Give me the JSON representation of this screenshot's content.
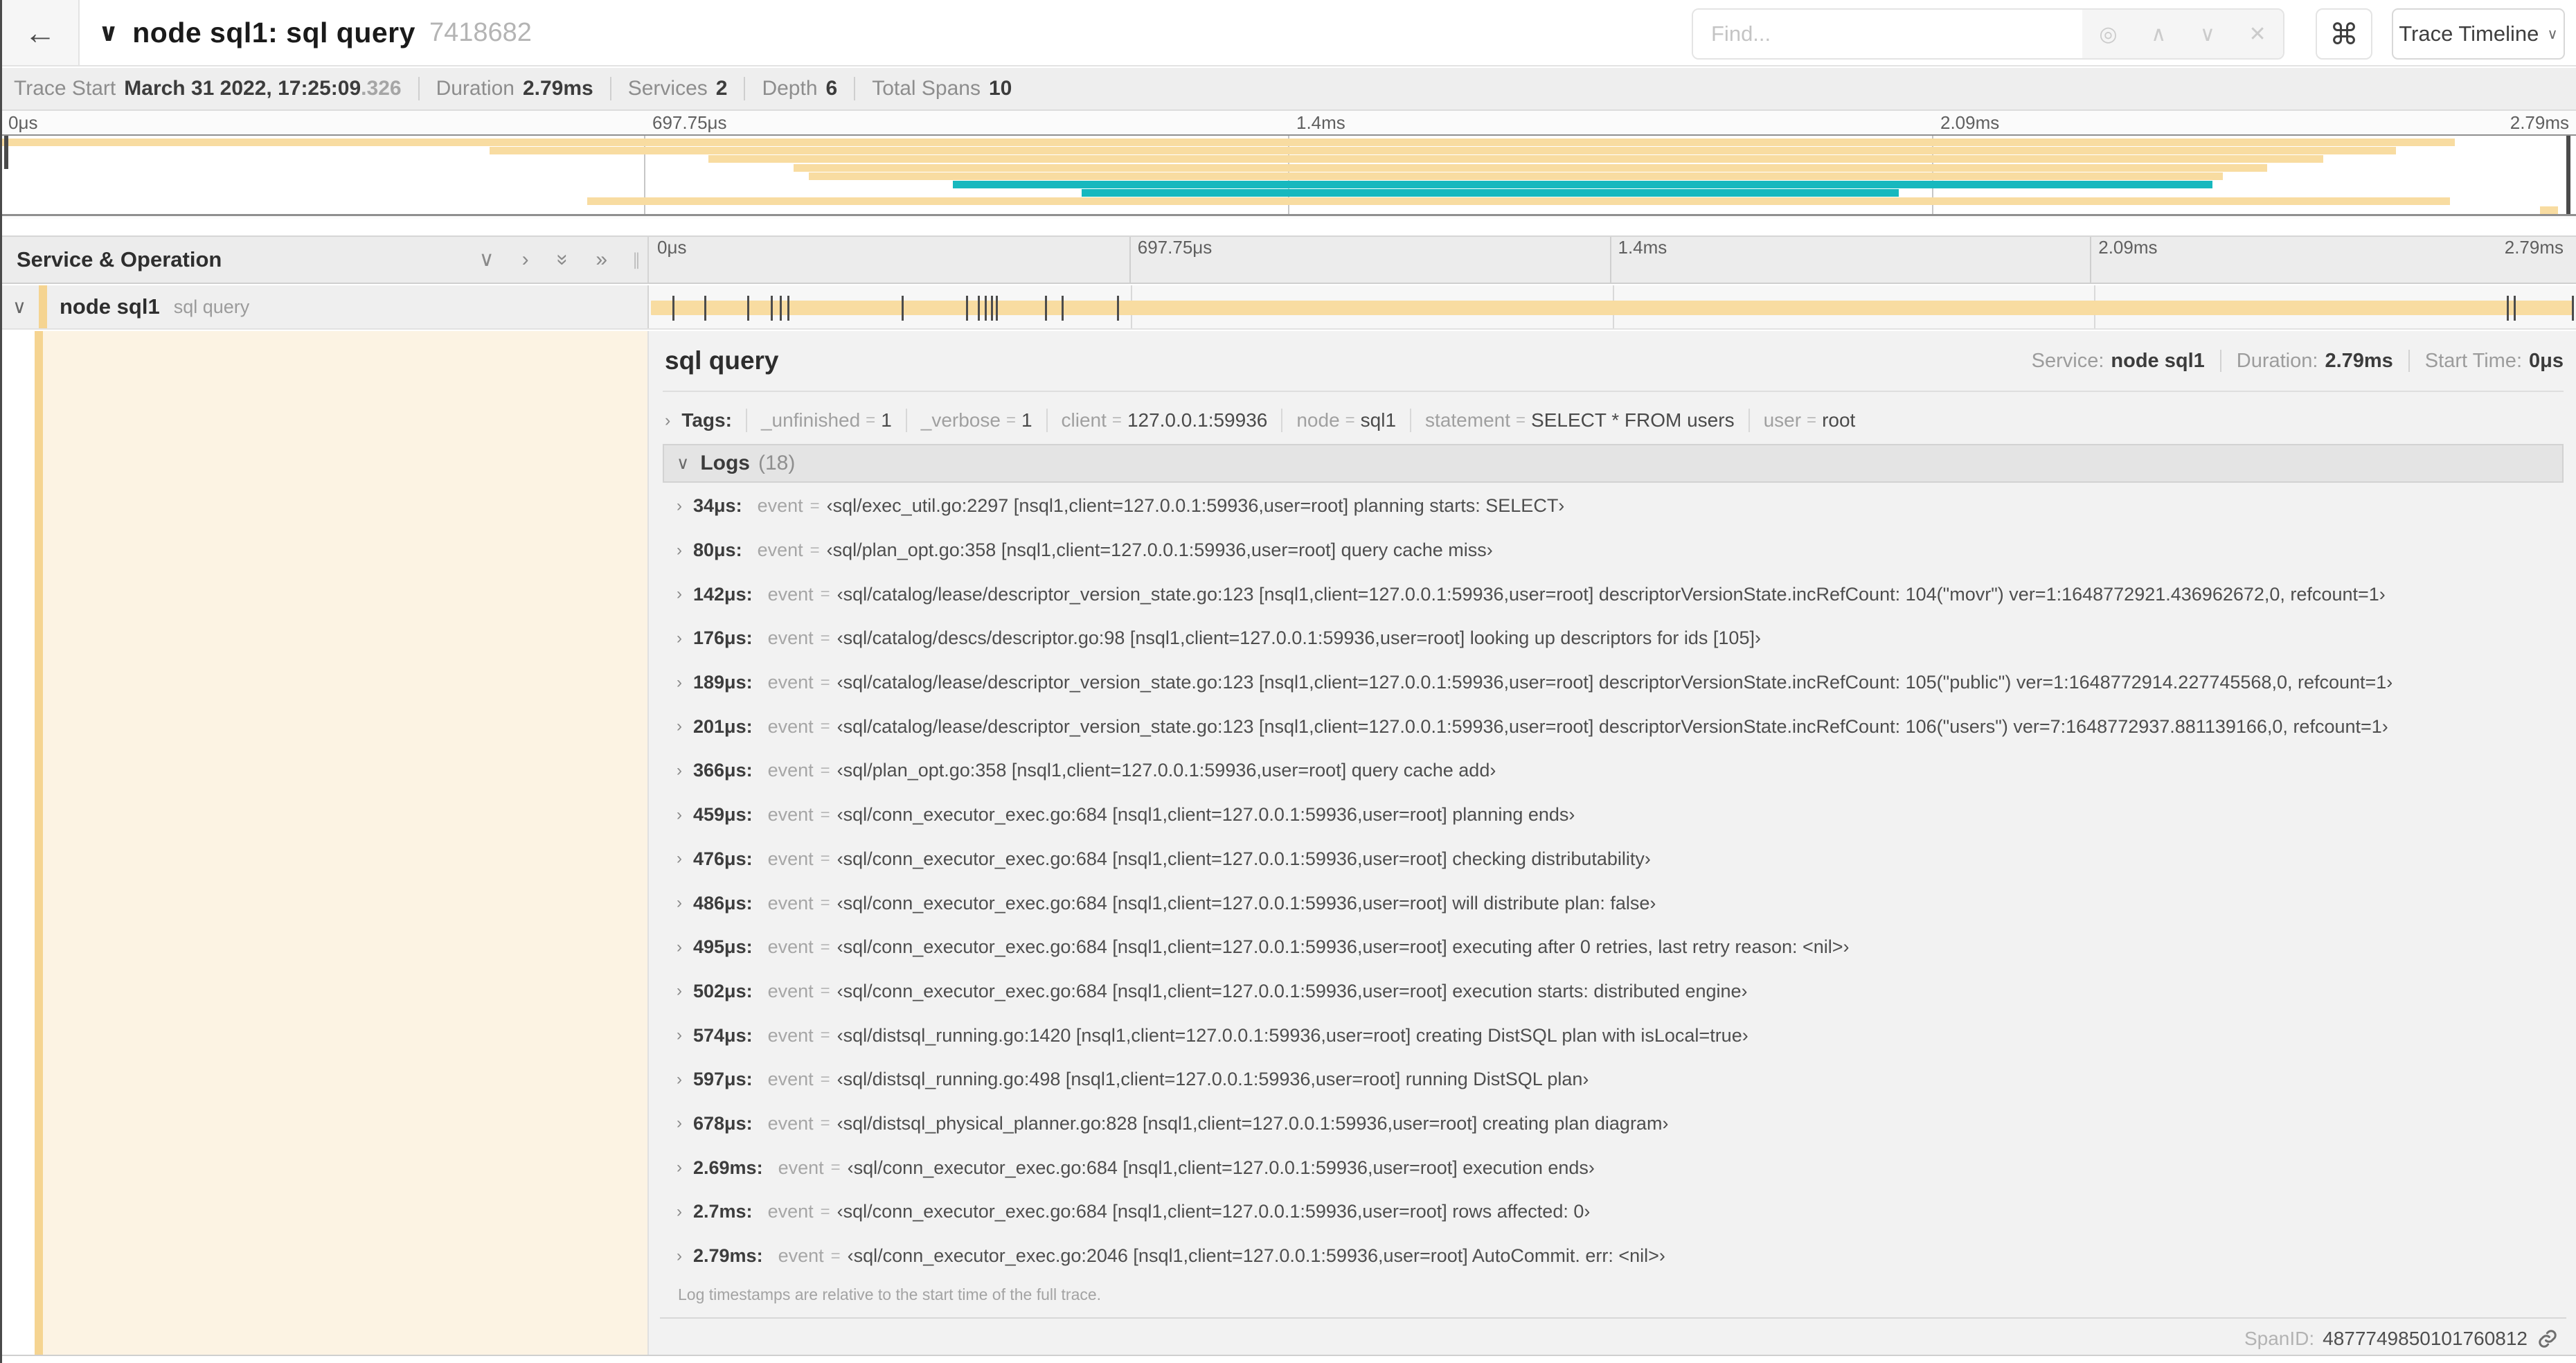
{
  "colors": {
    "tan": "#F8DCA1",
    "teal": "#17B8BE",
    "stripe": "#F5D491"
  },
  "topbar": {
    "back_icon": "←",
    "collapse_icon": "∨",
    "title": "node sql1: sql query",
    "trace_id": "7418682",
    "find_placeholder": "Find...",
    "shortcut_icon": "⌘",
    "view_selector": "Trace Timeline",
    "view_chevron": "∨"
  },
  "meta": {
    "items": [
      {
        "label": "Trace Start",
        "value": "March 31 2022, 17:25:09",
        "muted_suffix": ".326"
      },
      {
        "label": "Duration",
        "value": "2.79ms"
      },
      {
        "label": "Services",
        "value": "2"
      },
      {
        "label": "Depth",
        "value": "6"
      },
      {
        "label": "Total Spans",
        "value": "10"
      }
    ]
  },
  "ruler": {
    "labels": [
      "0μs",
      "697.75μs",
      "1.4ms",
      "2.09ms",
      "2.79ms"
    ],
    "fractions": [
      0,
      25,
      50,
      75,
      100
    ]
  },
  "minimap": {
    "rows": [
      {
        "start": 0,
        "end": 95.3,
        "color": "tan"
      },
      {
        "start": 19,
        "end": 93,
        "color": "tan"
      },
      {
        "start": 27.5,
        "end": 90.2,
        "color": "tan"
      },
      {
        "start": 30.8,
        "end": 88,
        "color": "tan"
      },
      {
        "start": 31.4,
        "end": 86.3,
        "color": "tan"
      },
      {
        "start": 37,
        "end": 85.9,
        "color": "teal"
      },
      {
        "start": 42,
        "end": 73.7,
        "color": "teal"
      },
      {
        "start": 22.8,
        "end": 95.1,
        "color": "tan"
      },
      {
        "start": 98.6,
        "end": 99.3,
        "color": "tan"
      }
    ]
  },
  "timeline": {
    "column_header": "Service & Operation",
    "expander_icons": {
      "collapse_one": "∨",
      "expand_one": "›",
      "collapse_all": "»",
      "expand_all": "»"
    },
    "row": {
      "expander": "∨",
      "service": "node sql1",
      "operation": "sql query"
    },
    "bar": {
      "start_pct": 0.1,
      "end_pct": 99.9
    },
    "tick_fractions": [
      1.22,
      2.87,
      5.09,
      6.31,
      6.78,
      7.2,
      13.12,
      16.45,
      17.06,
      17.42,
      17.74,
      18.0,
      20.57,
      21.4,
      24.3,
      96.42,
      96.77,
      99.8
    ]
  },
  "detail": {
    "title": "sql query",
    "overview": [
      {
        "label": "Service:",
        "value": "node sql1"
      },
      {
        "label": "Duration:",
        "value": "2.79ms"
      },
      {
        "label": "Start Time:",
        "value": "0μs"
      }
    ],
    "tags_chevron": "›",
    "tags_label": "Tags:",
    "tags": [
      {
        "key": "_unfinished",
        "value": "1"
      },
      {
        "key": "_verbose",
        "value": "1"
      },
      {
        "key": "client",
        "value": "127.0.0.1:59936"
      },
      {
        "key": "node",
        "value": "sql1"
      },
      {
        "key": "statement",
        "value": "SELECT * FROM users"
      },
      {
        "key": "user",
        "value": "root"
      }
    ],
    "logs_chevron": "∨",
    "logs_label": "Logs",
    "logs_count": "(18)",
    "logs": [
      {
        "time": "34μs",
        "field": "event",
        "value": "‹sql/exec_util.go:2297 [nsql1,client=127.0.0.1:59936,user=root] planning starts: SELECT›"
      },
      {
        "time": "80μs",
        "field": "event",
        "value": "‹sql/plan_opt.go:358 [nsql1,client=127.0.0.1:59936,user=root] query cache miss›"
      },
      {
        "time": "142μs",
        "field": "event",
        "value": "‹sql/catalog/lease/descriptor_version_state.go:123 [nsql1,client=127.0.0.1:59936,user=root] descriptorVersionState.incRefCount: 104(\"movr\") ver=1:1648772921.436962672,0, refcount=1›"
      },
      {
        "time": "176μs",
        "field": "event",
        "value": "‹sql/catalog/descs/descriptor.go:98 [nsql1,client=127.0.0.1:59936,user=root] looking up descriptors for ids [105]›"
      },
      {
        "time": "189μs",
        "field": "event",
        "value": "‹sql/catalog/lease/descriptor_version_state.go:123 [nsql1,client=127.0.0.1:59936,user=root] descriptorVersionState.incRefCount: 105(\"public\") ver=1:1648772914.227745568,0, refcount=1›"
      },
      {
        "time": "201μs",
        "field": "event",
        "value": "‹sql/catalog/lease/descriptor_version_state.go:123 [nsql1,client=127.0.0.1:59936,user=root] descriptorVersionState.incRefCount: 106(\"users\") ver=7:1648772937.881139166,0, refcount=1›"
      },
      {
        "time": "366μs",
        "field": "event",
        "value": "‹sql/plan_opt.go:358 [nsql1,client=127.0.0.1:59936,user=root] query cache add›"
      },
      {
        "time": "459μs",
        "field": "event",
        "value": "‹sql/conn_executor_exec.go:684 [nsql1,client=127.0.0.1:59936,user=root] planning ends›"
      },
      {
        "time": "476μs",
        "field": "event",
        "value": "‹sql/conn_executor_exec.go:684 [nsql1,client=127.0.0.1:59936,user=root] checking distributability›"
      },
      {
        "time": "486μs",
        "field": "event",
        "value": "‹sql/conn_executor_exec.go:684 [nsql1,client=127.0.0.1:59936,user=root] will distribute plan: false›"
      },
      {
        "time": "495μs",
        "field": "event",
        "value": "‹sql/conn_executor_exec.go:684 [nsql1,client=127.0.0.1:59936,user=root] executing after 0 retries, last retry reason: <nil>›"
      },
      {
        "time": "502μs",
        "field": "event",
        "value": "‹sql/conn_executor_exec.go:684 [nsql1,client=127.0.0.1:59936,user=root] execution starts: distributed engine›"
      },
      {
        "time": "574μs",
        "field": "event",
        "value": "‹sql/distsql_running.go:1420 [nsql1,client=127.0.0.1:59936,user=root] creating DistSQL plan with isLocal=true›"
      },
      {
        "time": "597μs",
        "field": "event",
        "value": "‹sql/distsql_running.go:498 [nsql1,client=127.0.0.1:59936,user=root] running DistSQL plan›"
      },
      {
        "time": "678μs",
        "field": "event",
        "value": "‹sql/distsql_physical_planner.go:828 [nsql1,client=127.0.0.1:59936,user=root] creating plan diagram›"
      },
      {
        "time": "2.69ms",
        "field": "event",
        "value": "‹sql/conn_executor_exec.go:684 [nsql1,client=127.0.0.1:59936,user=root] execution ends›"
      },
      {
        "time": "2.7ms",
        "field": "event",
        "value": "‹sql/conn_executor_exec.go:684 [nsql1,client=127.0.0.1:59936,user=root] rows affected: 0›"
      },
      {
        "time": "2.79ms",
        "field": "event",
        "value": "‹sql/conn_executor_exec.go:2046 [nsql1,client=127.0.0.1:59936,user=root] AutoCommit. err: <nil>›"
      }
    ],
    "note": "Log timestamps are relative to the start time of the full trace.",
    "span_id_label": "SpanID:",
    "span_id": "4877749850101760812"
  }
}
